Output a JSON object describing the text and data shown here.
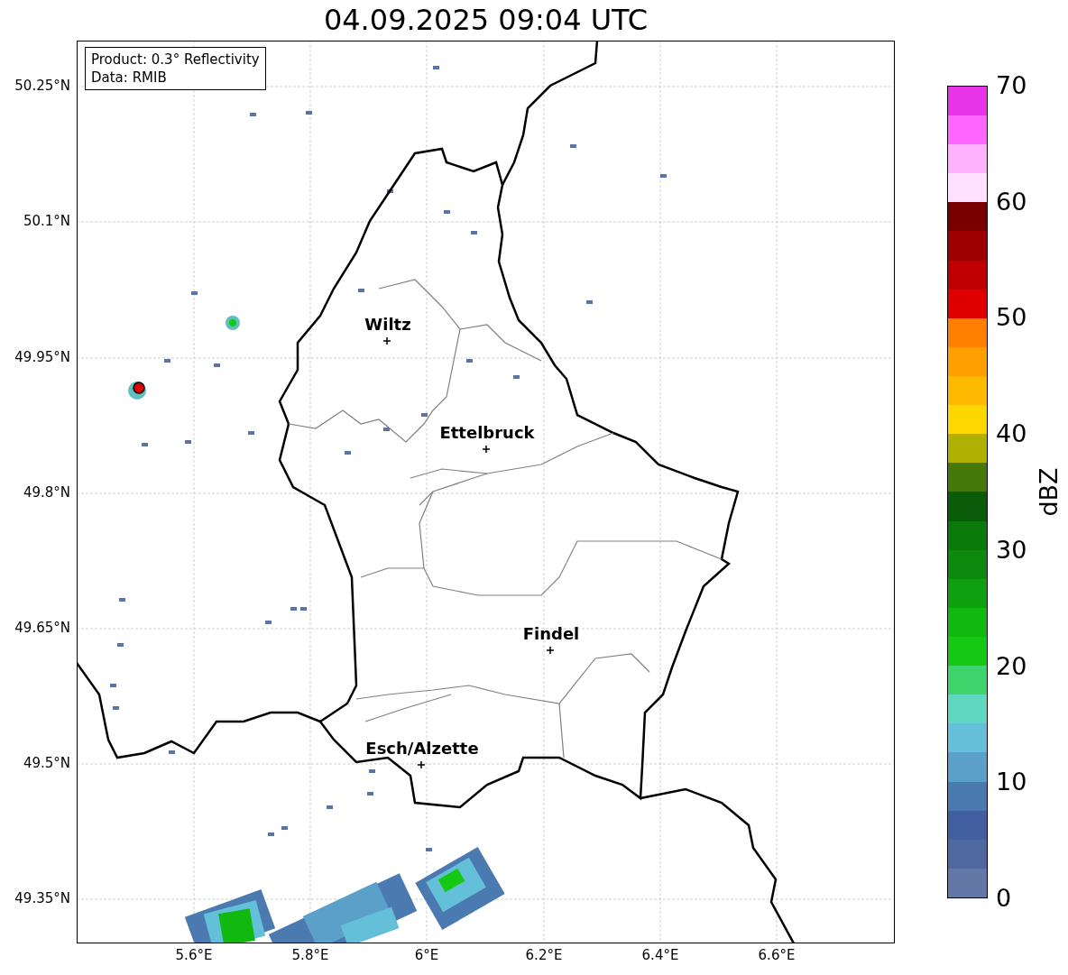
{
  "title": "04.09.2025 09:04 UTC",
  "info_box": [
    "Product: 0.3° Reflectivity",
    "Data: RMIB"
  ],
  "cities": [
    "Wiltz",
    "Ettelbruck",
    "Findel",
    "Esch/Alzette"
  ],
  "y_ticks": [
    "50.25°N",
    "50.1°N",
    "49.95°N",
    "49.8°N",
    "49.65°N",
    "49.5°N",
    "49.35°N"
  ],
  "x_ticks": [
    "5.6°E",
    "5.8°E",
    "6°E",
    "6.2°E",
    "6.4°E",
    "6.6°E"
  ],
  "colorbar": {
    "label": "dBZ",
    "ticks": [
      "70",
      "60",
      "50",
      "40",
      "30",
      "20",
      "10",
      "0"
    ],
    "bands": [
      {
        "color": "#6478a8"
      },
      {
        "color": "#5068a0"
      },
      {
        "color": "#4260a0"
      },
      {
        "color": "#4a7ab0"
      },
      {
        "color": "#5aa0c8"
      },
      {
        "color": "#64c0d8"
      },
      {
        "color": "#60d8c0"
      },
      {
        "color": "#3dd46b"
      },
      {
        "color": "#14c814"
      },
      {
        "color": "#10b810"
      },
      {
        "color": "#0fa00f"
      },
      {
        "color": "#0d8a0d"
      },
      {
        "color": "#0a7a0a"
      },
      {
        "color": "#0a5c0a"
      },
      {
        "color": "#457a0a"
      },
      {
        "color": "#b0b000"
      },
      {
        "color": "#ffd700"
      },
      {
        "color": "#ffba00"
      },
      {
        "color": "#ff9f00"
      },
      {
        "color": "#ff7f00"
      },
      {
        "color": "#e00000"
      },
      {
        "color": "#c00000"
      },
      {
        "color": "#9e0000"
      },
      {
        "color": "#7a0000"
      },
      {
        "color": "#ffe0ff"
      },
      {
        "color": "#ffb3ff"
      },
      {
        "color": "#ff66ff"
      },
      {
        "color": "#e833e8"
      }
    ]
  }
}
